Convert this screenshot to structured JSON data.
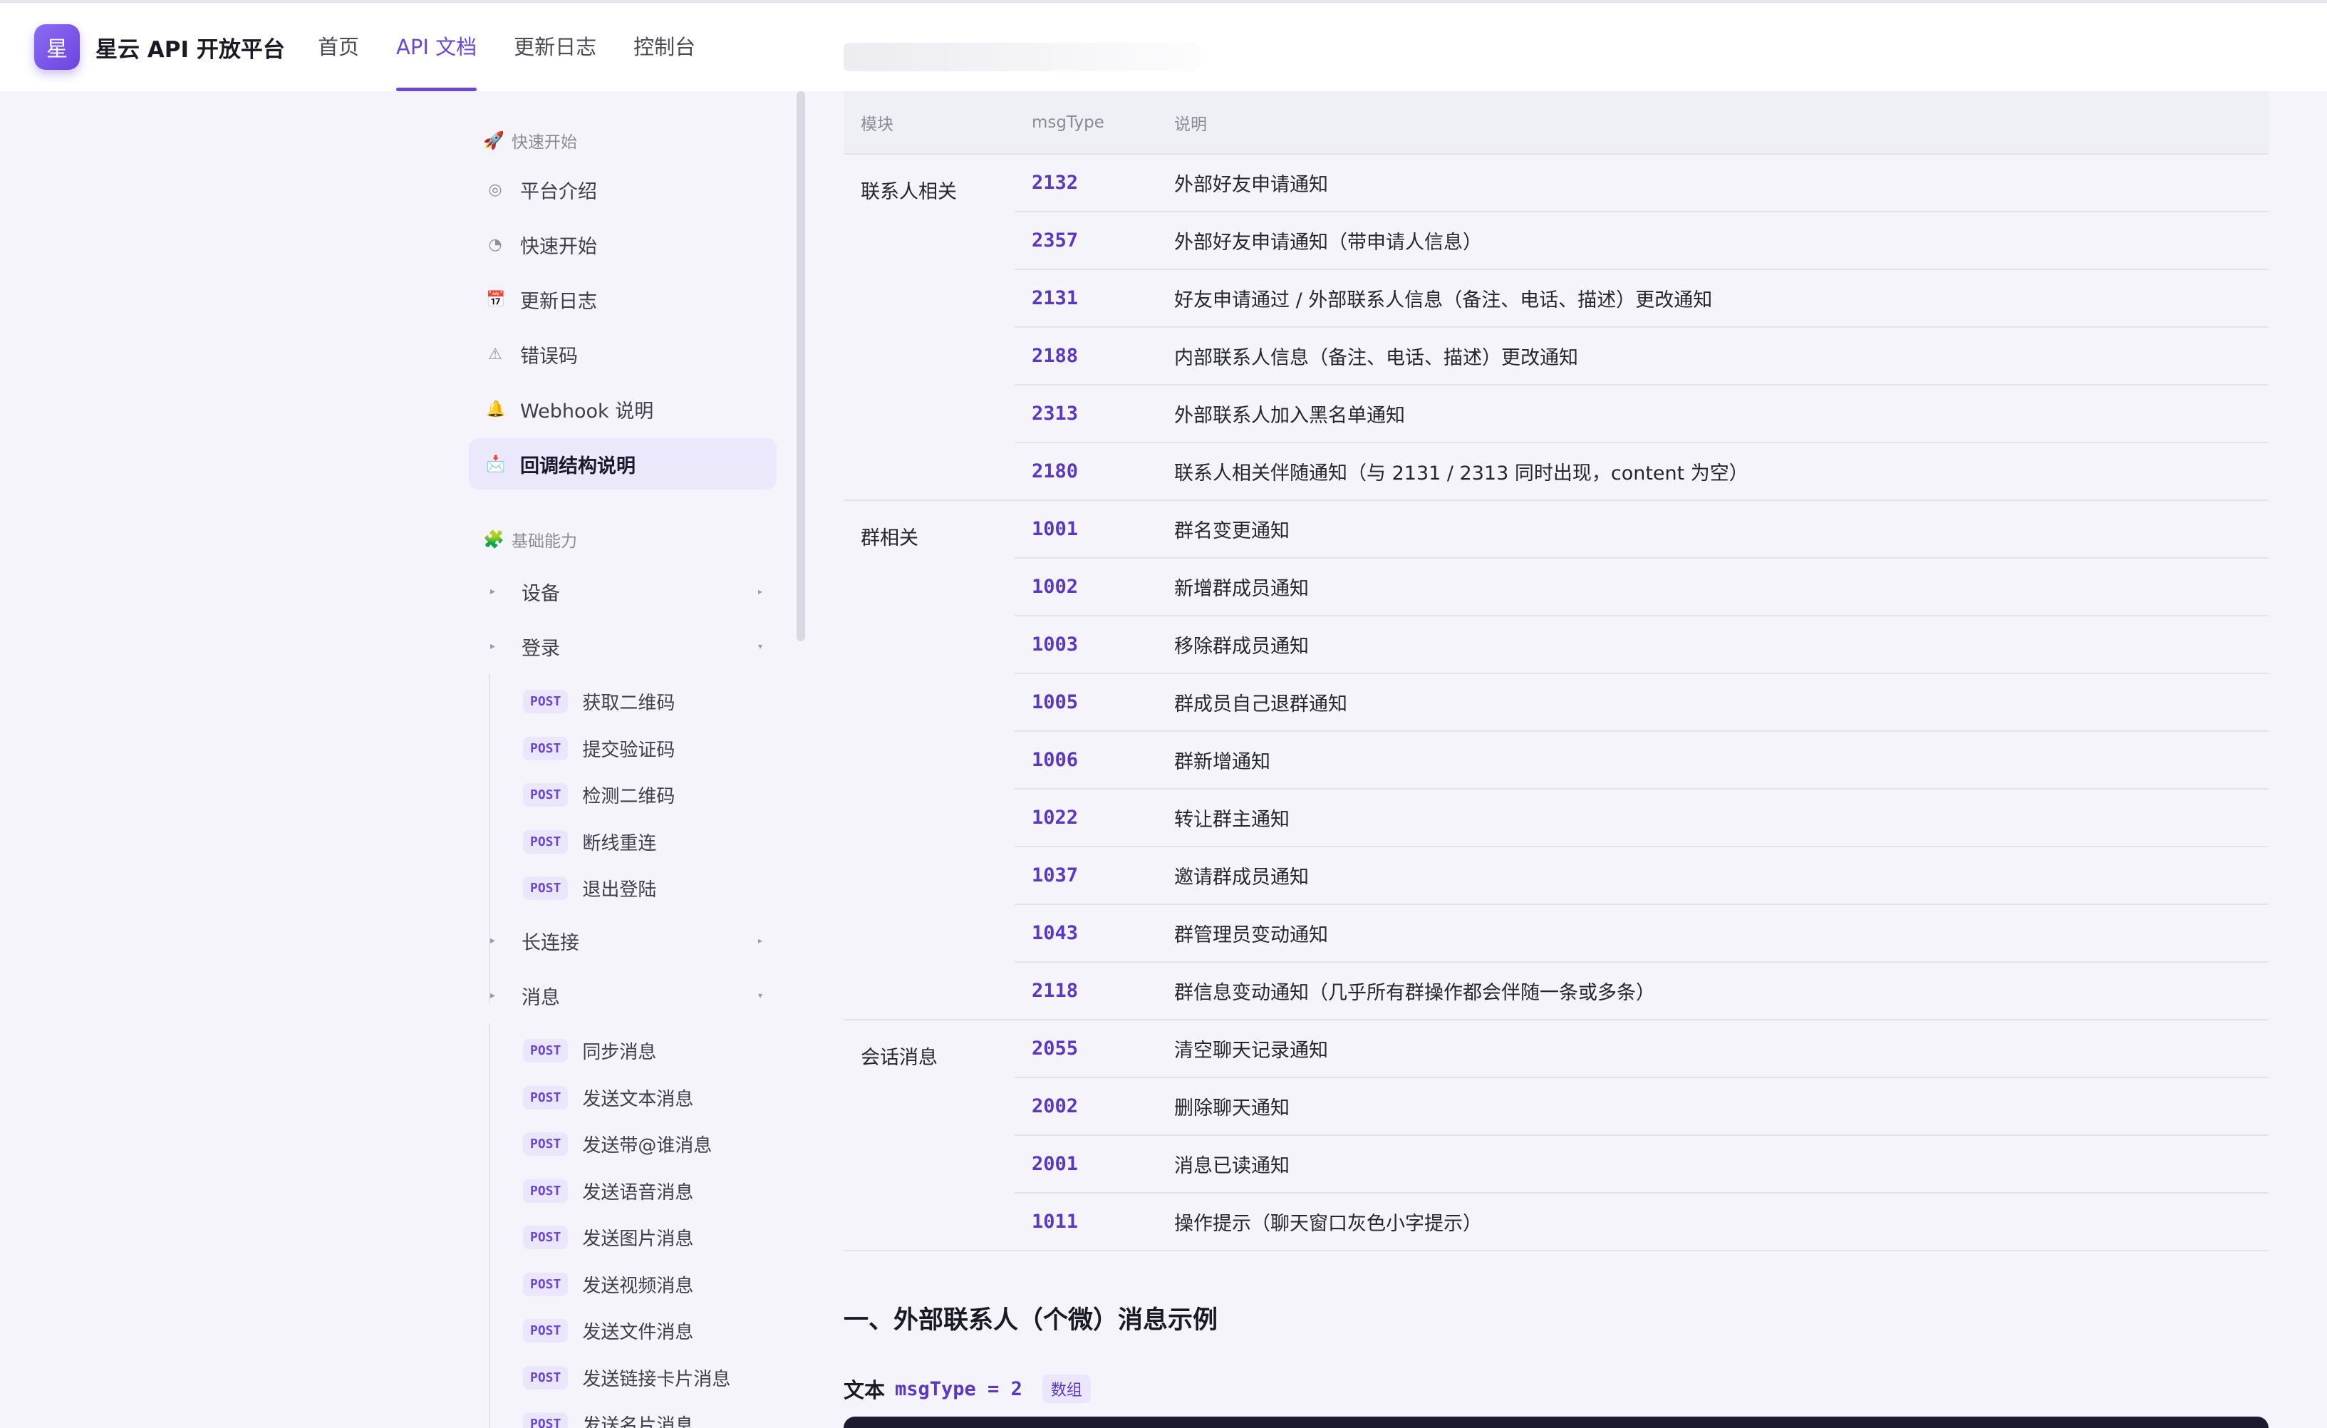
{
  "header": {
    "logo_char": "星",
    "brand": "星云 API 开放平台",
    "nav": [
      "首页",
      "API 文档",
      "更新日志",
      "控制台"
    ],
    "active_nav": "API 文档"
  },
  "sidebar": {
    "group1": {
      "icon": "🚀",
      "title": "快速开始"
    },
    "items1": [
      {
        "icon": "◎",
        "label": "平台介绍"
      },
      {
        "icon": "◔",
        "label": "快速开始"
      },
      {
        "icon": "📅",
        "label": "更新日志"
      },
      {
        "icon": "⚠",
        "label": "错误码"
      },
      {
        "icon": "🔔",
        "label": "Webhook 说明"
      },
      {
        "icon": "📩",
        "label": "回调结构说明",
        "active": true
      }
    ],
    "group2": {
      "icon": "🧩",
      "title": "基础能力"
    },
    "folders": [
      "设备",
      "登录",
      "长连接",
      "消息"
    ],
    "method": "POST",
    "login_apis": [
      "获取二维码",
      "提交验证码",
      "检测二维码",
      "断线重连",
      "退出登陆"
    ],
    "message_apis": [
      "同步消息",
      "发送文本消息",
      "发送带@谁消息",
      "发送语音消息",
      "发送图片消息",
      "发送视频消息",
      "发送文件消息",
      "发送链接卡片消息",
      "发送名片消息"
    ]
  },
  "table": {
    "headers": [
      "模块",
      "msgType",
      "说明"
    ],
    "groups": [
      {
        "module": "联系人相关",
        "rows": [
          [
            "2132",
            "外部好友申请通知"
          ],
          [
            "2357",
            "外部好友申请通知（带申请人信息）"
          ],
          [
            "2131",
            "好友申请通过 / 外部联系人信息（备注、电话、描述）更改通知"
          ],
          [
            "2188",
            "内部联系人信息（备注、电话、描述）更改通知"
          ],
          [
            "2313",
            "外部联系人加入黑名单通知"
          ],
          [
            "2180",
            "联系人相关伴随通知（与 2131 / 2313 同时出现，content 为空）"
          ]
        ]
      },
      {
        "module": "群相关",
        "rows": [
          [
            "1001",
            "群名变更通知"
          ],
          [
            "1002",
            "新增群成员通知"
          ],
          [
            "1003",
            "移除群成员通知"
          ],
          [
            "1005",
            "群成员自己退群通知"
          ],
          [
            "1006",
            "群新增通知"
          ],
          [
            "1022",
            "转让群主通知"
          ],
          [
            "1037",
            "邀请群成员通知"
          ],
          [
            "1043",
            "群管理员变动通知"
          ],
          [
            "2118",
            "群信息变动通知（几乎所有群操作都会伴随一条或多条）"
          ]
        ]
      },
      {
        "module": "会话消息",
        "rows": [
          [
            "2055",
            "清空聊天记录通知"
          ],
          [
            "2002",
            "删除聊天通知"
          ],
          [
            "2001",
            "消息已读通知"
          ],
          [
            "1011",
            "操作提示（聊天窗口灰色小字提示）"
          ]
        ]
      }
    ]
  },
  "section": {
    "heading": "一、外部联系人（个微）消息示例",
    "sub_label": "文本",
    "sub_expr": "msgType = 2",
    "sub_tag": "数组"
  },
  "colors": {
    "accent": "#6a47d6",
    "code": "#5a37c4",
    "background": "#f4f4fa"
  }
}
